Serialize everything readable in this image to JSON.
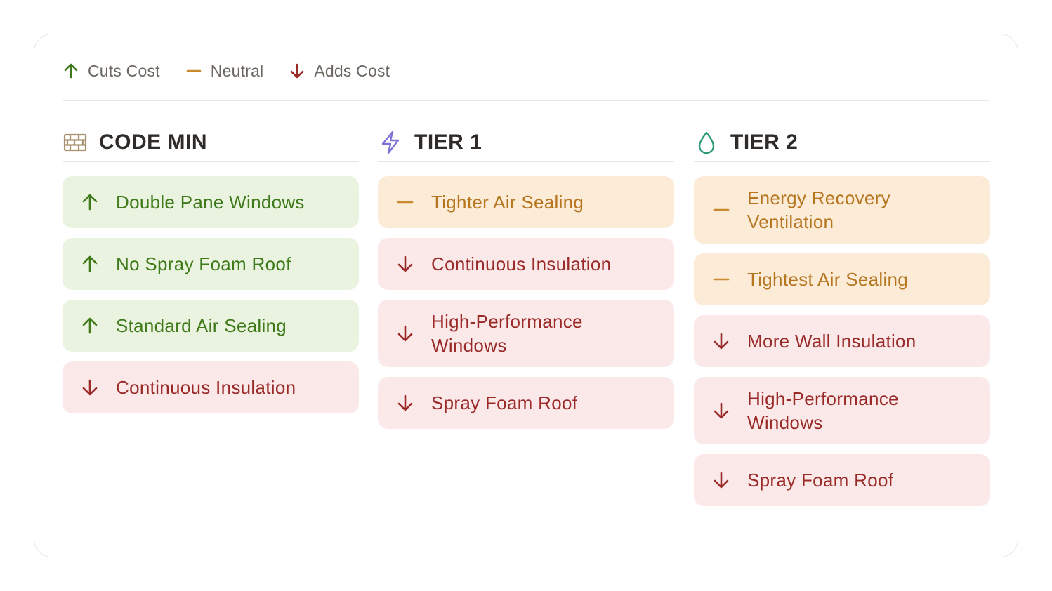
{
  "legend": [
    {
      "label": "Cuts Cost",
      "icon": "arrow-up-icon",
      "color": "#3f7a1a"
    },
    {
      "label": "Neutral",
      "icon": "dash-icon",
      "color": "#c98a2e"
    },
    {
      "label": "Adds Cost",
      "icon": "arrow-down-icon",
      "color": "#9a2a28"
    }
  ],
  "columns": [
    {
      "title": "CODE MIN",
      "icon": "brick-wall-icon",
      "icon_color": "#a8906e",
      "items": [
        {
          "label": "Double Pane Windows",
          "effect": "cut"
        },
        {
          "label": "No Spray Foam Roof",
          "effect": "cut"
        },
        {
          "label": "Standard Air Sealing",
          "effect": "cut"
        },
        {
          "label": "Continuous Insulation",
          "effect": "adds"
        }
      ]
    },
    {
      "title": "TIER 1",
      "icon": "lightning-icon",
      "icon_color": "#7b72d6",
      "items": [
        {
          "label": "Tighter Air Sealing",
          "effect": "neutral"
        },
        {
          "label": "Continuous Insulation",
          "effect": "adds"
        },
        {
          "label": "High-Performance Windows",
          "effect": "adds"
        },
        {
          "label": "Spray Foam Roof",
          "effect": "adds"
        }
      ]
    },
    {
      "title": "TIER 2",
      "icon": "droplet-icon",
      "icon_color": "#2f9a7c",
      "items": [
        {
          "label": "Energy Recovery Ventilation",
          "effect": "neutral"
        },
        {
          "label": "Tightest Air Sealing",
          "effect": "neutral"
        },
        {
          "label": "More Wall Insulation",
          "effect": "adds"
        },
        {
          "label": "High-Performance Windows",
          "effect": "adds"
        },
        {
          "label": "Spray Foam Roof",
          "effect": "adds"
        }
      ]
    }
  ]
}
